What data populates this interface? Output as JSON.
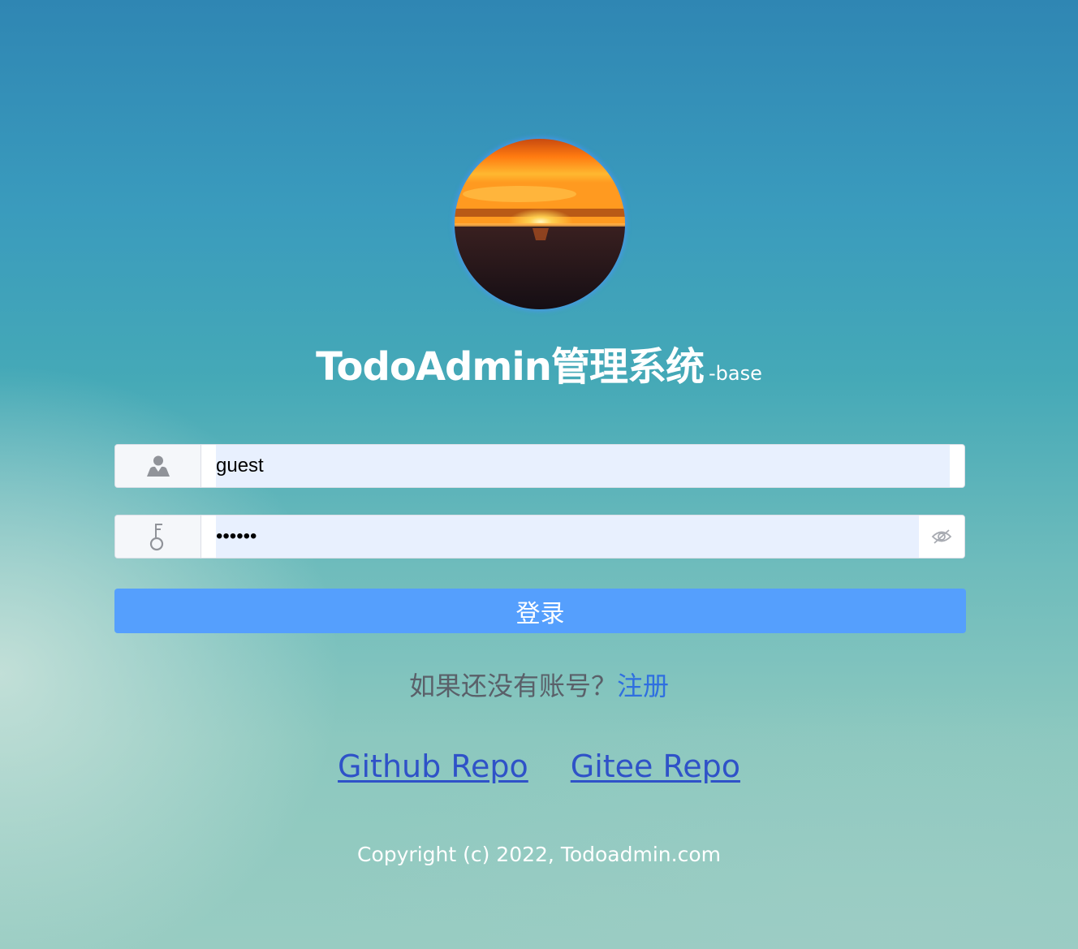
{
  "logo": {
    "icon": "sunset-logo-icon"
  },
  "title": {
    "main": "TodoAdmin管理系统",
    "sub": "-base"
  },
  "username": {
    "value": "guest",
    "icon": "user-icon"
  },
  "password": {
    "value": "••••••",
    "icon": "key-icon",
    "toggle_icon": "eye-off-icon"
  },
  "login_button": {
    "label": "登录"
  },
  "register": {
    "prompt": "如果还没有账号？",
    "link": "注册"
  },
  "repos": {
    "github": "Github Repo",
    "gitee": "Gitee Repo"
  },
  "footer": {
    "copyright": "Copyright (c) 2022, Todoadmin.com"
  },
  "colors": {
    "accent": "#559ffd",
    "link": "#2f52c8",
    "register_link": "#2f6fe0",
    "input_fill": "#e8f0fe"
  }
}
